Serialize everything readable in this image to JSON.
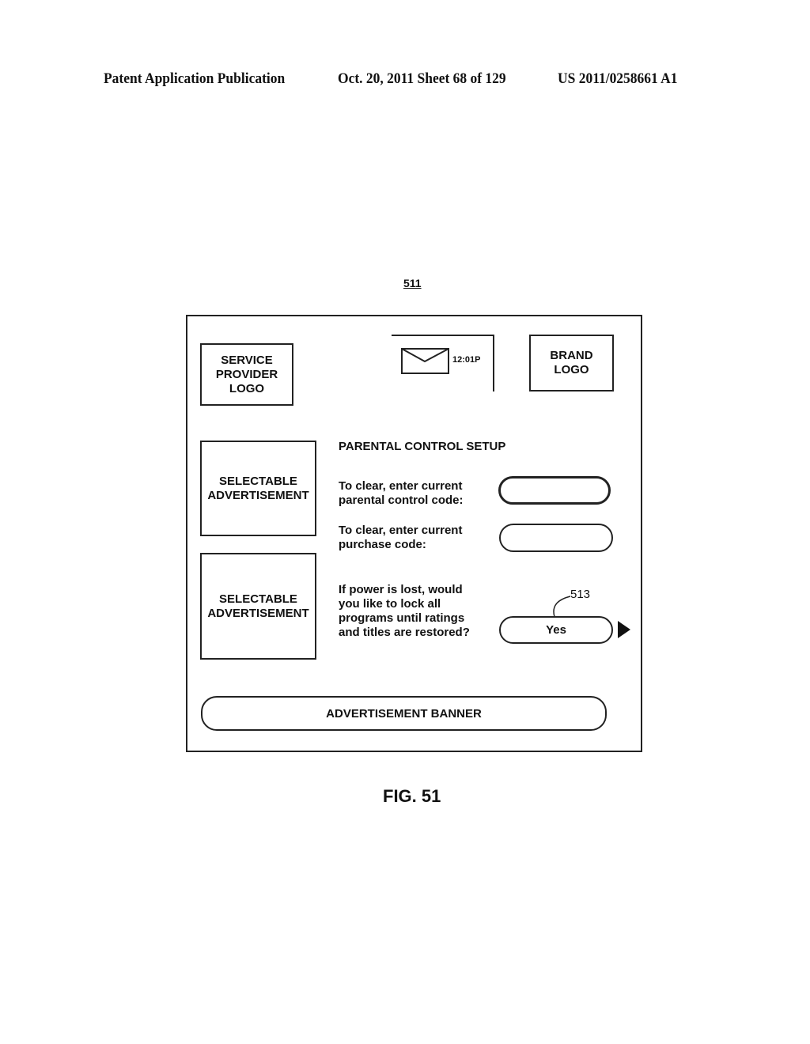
{
  "header": {
    "publication": "Patent Application Publication",
    "date_sheet": "Oct. 20, 2011   Sheet 68 of 129",
    "patent_number": "US 2011/0258661 A1"
  },
  "figure": {
    "reference_number": "511",
    "caption": "FIG. 51"
  },
  "screen": {
    "service_provider_logo": "SERVICE\nPROVIDER\nLOGO",
    "brand_logo": "BRAND\nLOGO",
    "status": {
      "icon": "envelope-icon",
      "time": "12:01P"
    },
    "ads": [
      {
        "label": "SELECTABLE\nADVERTISEMENT"
      },
      {
        "label": "SELECTABLE\nADVERTISEMENT"
      }
    ],
    "title": "PARENTAL CONTROL SETUP",
    "fields": [
      {
        "label": "To clear, enter current\nparental control code:",
        "value": ""
      },
      {
        "label": "To clear, enter current\npurchase code:",
        "value": ""
      }
    ],
    "power_question": {
      "label": "If power is lost, would\nyou like to lock all\nprograms until ratings\nand titles are restored?",
      "selected": "Yes",
      "callout": "513",
      "next_icon": "triangle-right-icon"
    },
    "banner": "ADVERTISEMENT BANNER"
  }
}
